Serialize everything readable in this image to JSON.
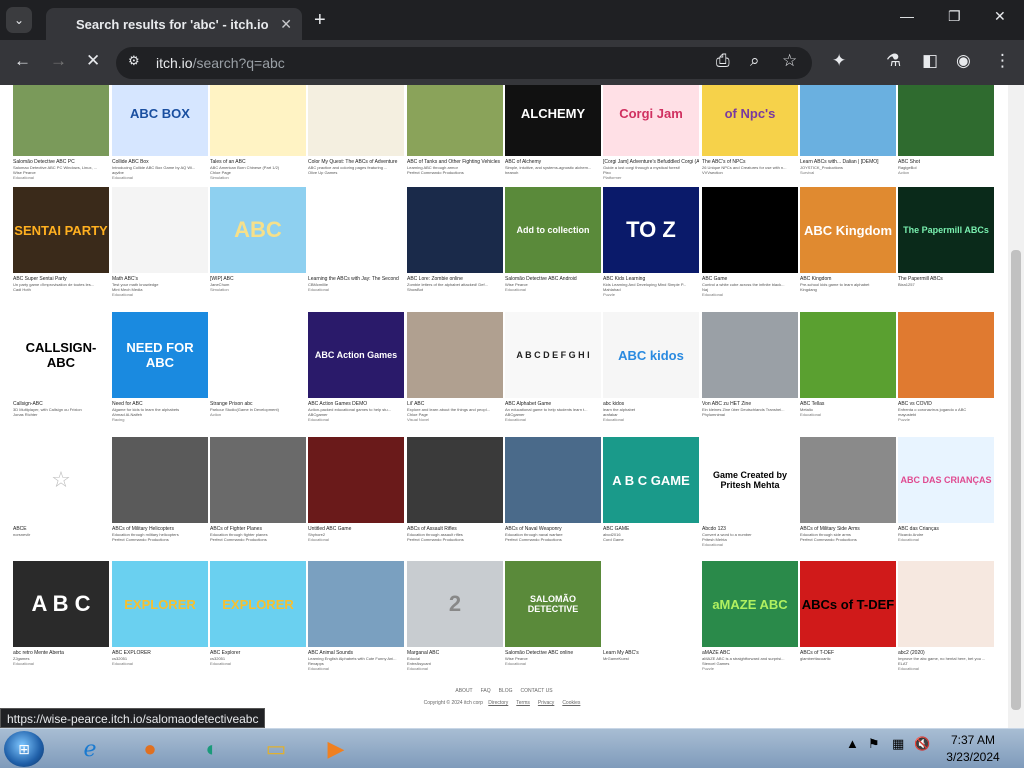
{
  "browser": {
    "tab_title": "Search results for 'abc' - itch.io",
    "url_domain": "itch.io",
    "url_path": "/search?q=abc",
    "status_url": "https://wise-pearce.itch.io/salomaodetectiveabc"
  },
  "rows": [
    [
      {
        "title": "Salomão Detective ABC PC",
        "desc": "Salomao Detective ABC PC Windows, Linux, ...",
        "author": "Wise Pearce",
        "genre": "Educational",
        "bg": "#7a9a5a",
        "fg": "#fff",
        "label": ""
      },
      {
        "title": "Collide ABC Box",
        "desc": "Introducing Collide ABC Box Game by AQ Wi...",
        "author": "aqvibe",
        "genre": "Educational",
        "bg": "#d6e6ff",
        "fg": "#1a4fa0",
        "label": "ABC BOX"
      },
      {
        "title": "Tales of an ABC",
        "desc": "ABC American Born Chinese (Part 1/2)",
        "author": "Chloe Page",
        "genre": "Simulation",
        "bg": "#fff3c4",
        "fg": "#a06a20",
        "label": ""
      },
      {
        "title": "Color My Quest: The ABCs of Adventure",
        "desc": "ABC practice and coloring pages featuring ...",
        "author": "Olive Up Games",
        "genre": "",
        "bg": "#f4efe0",
        "fg": "#5a4a2a",
        "label": ""
      },
      {
        "title": "ABC of Tanks and Other Fighting Vehicles",
        "desc": "Learning ABC through armor",
        "author": "Perfect Commando Productions",
        "genre": "",
        "bg": "#8aa35a",
        "fg": "#fff",
        "label": ""
      },
      {
        "title": "ABC of Alchemy",
        "desc": "Simple, intuitive, and systems-agnostic alchem...",
        "author": "heanoh",
        "genre": "",
        "bg": "#111",
        "fg": "#fff",
        "label": "ALCHEMY"
      },
      {
        "title": "[Corgi Jam] Adventure's Befuddled Corgi (ABC)",
        "desc": "Guide a lost corgi through a mystical forest!",
        "author": "Pixo",
        "genre": "Platformer",
        "bg": "#ffe0e6",
        "fg": "#d03060",
        "label": "Corgi Jam"
      },
      {
        "title": "The ABC's of NPCs",
        "desc": "26 Unique NPCs and Creatures for use with n...",
        "author": "VVVsection",
        "genre": "",
        "bg": "#f6d24a",
        "fg": "#7a3aa0",
        "label": "of Npc's"
      },
      {
        "title": "Learn ABCs with... Dalian | [DEMO]",
        "desc": "",
        "author": "JOYSTICK_Productions",
        "genre": "Survival",
        "bg": "#6ab0e0",
        "fg": "#fff",
        "label": ""
      },
      {
        "title": "ABC Shot",
        "desc": "",
        "author": "RagigeBol",
        "genre": "Action",
        "bg": "#2f6b2f",
        "fg": "#fff",
        "label": ""
      }
    ],
    [
      {
        "title": "ABC Super Sentai Party",
        "desc": "Un party game d'improvisation de toutes les...",
        "author": "Cadi Hoth",
        "genre": "",
        "bg": "#3a2a1a",
        "fg": "#ffb020",
        "label": "SENTAI PARTY"
      },
      {
        "title": "Math ABC's",
        "desc": "Test your math knowledge",
        "author": "Mint Mech Media",
        "genre": "Educational",
        "bg": "#f4f4f4",
        "fg": "#333",
        "label": ""
      },
      {
        "title": "[WIP] ABC",
        "desc": "",
        "author": "JaneChum",
        "genre": "Simulation",
        "bg": "#8ed0f0",
        "fg": "#f6e08a",
        "label": "ABC"
      },
      {
        "title": "Learning the ABCs with Jay: The Second",
        "desc": "",
        "author": "CBMcmillie",
        "genre": "Educational",
        "bg": "#fff",
        "fg": "#6a3a20",
        "label": ""
      },
      {
        "title": "ABC Lore: Zombie online",
        "desc": "Zombie letters of the alphabet attacked! Def...",
        "author": "ShowBot",
        "genre": "",
        "bg": "#1a2a4a",
        "fg": "#fff",
        "label": ""
      },
      {
        "title": "Salomão Detective ABC Android",
        "desc": "",
        "author": "Wise Pearce",
        "genre": "Educational",
        "bg": "#5a8a3a",
        "fg": "#fff",
        "label": "Add to collection"
      },
      {
        "title": "ABC Kids Learning",
        "desc": "Kids Learning And Developing Mind Simple P...",
        "author": "Mahlahad",
        "genre": "Puzzle",
        "bg": "#0a1a6a",
        "fg": "#fff",
        "label": "TO Z"
      },
      {
        "title": "ABC Game",
        "desc": "Control a white cube across the infinite black...",
        "author": "Naj",
        "genre": "Educational",
        "bg": "#000",
        "fg": "#fff",
        "label": ""
      },
      {
        "title": "ABC Kingdom",
        "desc": "Pre-school kids game to learn alphabet",
        "author": "Kingdang",
        "genre": "",
        "bg": "#e08a30",
        "fg": "#fff",
        "label": "ABC Kingdom"
      },
      {
        "title": "The Papermill ABCs",
        "desc": "",
        "author": "Bixa1257",
        "genre": "",
        "bg": "#0a2a1a",
        "fg": "#7af0b0",
        "label": "The Papermill ABCs"
      }
    ],
    [
      {
        "title": "Callsign-ABC",
        "desc": "3D Multiplayer, with Callsign ou Frixion",
        "author": "Jonas Richter",
        "genre": "",
        "bg": "#fff",
        "fg": "#000",
        "label": "CALLSIGN-ABC"
      },
      {
        "title": "Need for ABC",
        "desc": "Algame for kids to learn the alphabets",
        "author": "Ahmad Al-Naifeh",
        "genre": "Racing",
        "bg": "#1a8ae0",
        "fg": "#fff",
        "label": "NEED FOR ABC"
      },
      {
        "title": "Strange Prison abc",
        "desc": "Parkour Studio(Game in Development)",
        "author": "",
        "genre": "Action",
        "bg": "#fff",
        "fg": "#e04a20",
        "label": ""
      },
      {
        "title": "ABC Action Games DEMO",
        "desc": "Action-packed educational games to help stu...",
        "author": "ABCgamer",
        "genre": "Educational",
        "bg": "#2a1a6a",
        "fg": "#fff",
        "label": "ABC Action Games"
      },
      {
        "title": "Lil' ABC",
        "desc": "Explore and learn about the things and peopl...",
        "author": "Chloe Page",
        "genre": "Visual Novel",
        "bg": "#b0a090",
        "fg": "#fff",
        "label": ""
      },
      {
        "title": "ABC Alphabet Game",
        "desc": "An educational game to help students learn t...",
        "author": "ABCgamer",
        "genre": "Educational",
        "bg": "#f8f8f8",
        "fg": "#222",
        "label": "A B C D E F G H I"
      },
      {
        "title": "abc kidos",
        "desc": "learn the alphabet",
        "author": "arafakar",
        "genre": "Educational",
        "bg": "#f6f6f6",
        "fg": "#2a8ae0",
        "label": "ABC kidos"
      },
      {
        "title": "Von ABC zu HET Zine",
        "desc": "Ein kleines Zine über Deutschlands Transhei...",
        "author": "Phylumnimal",
        "genre": "",
        "bg": "#9aa0a6",
        "fg": "#fff",
        "label": ""
      },
      {
        "title": "ABC Tellas",
        "desc": "Metalio",
        "author": "",
        "genre": "Educational",
        "bg": "#5aa030",
        "fg": "#fff",
        "label": ""
      },
      {
        "title": "ABC vs COVID",
        "desc": "Enfrenta o coronavírus jogando o ABC",
        "author": "mayustebi",
        "genre": "Puzzle",
        "bg": "#e07a30",
        "fg": "#fff",
        "label": ""
      }
    ],
    [
      {
        "title": "ABCE",
        "desc": "",
        "author": "norsneviir",
        "genre": "",
        "bg": "#fff",
        "fg": "#bbb",
        "label": "☆"
      },
      {
        "title": "ABCs of Military Helicopters",
        "desc": "Education through military helicopters",
        "author": "Perfect Commando Productions",
        "genre": "",
        "bg": "#5a5a5a",
        "fg": "#fff",
        "label": ""
      },
      {
        "title": "ABCs of Fighter Planes",
        "desc": "Education through fighter planes",
        "author": "Perfect Commando Productions",
        "genre": "",
        "bg": "#6a6a6a",
        "fg": "#fff",
        "label": ""
      },
      {
        "title": "Untitled ABC Game",
        "desc": "",
        "author": "Shyhore2",
        "genre": "Educational",
        "bg": "#6a1a1a",
        "fg": "#fff",
        "label": ""
      },
      {
        "title": "ABCs of Assault Rifles",
        "desc": "Education through assault rifles",
        "author": "Perfect Commando Productions",
        "genre": "",
        "bg": "#3a3a3a",
        "fg": "#fff",
        "label": ""
      },
      {
        "title": "ABCs of Naval Weaponry",
        "desc": "Education through naval warfare",
        "author": "Perfect Commando Productions",
        "genre": "",
        "bg": "#4a6a8a",
        "fg": "#fff",
        "label": ""
      },
      {
        "title": "ABC GAME",
        "desc": "abcd2016",
        "author": "Cord Game",
        "genre": "",
        "bg": "#1a9a8a",
        "fg": "#fff",
        "label": "A B C GAME"
      },
      {
        "title": "Abcdo 123",
        "desc": "Convert a word to a number",
        "author": "Pritesh Mehta",
        "genre": "Educational",
        "bg": "#fff",
        "fg": "#000",
        "label": "Game Created by Pritesh Mehta"
      },
      {
        "title": "ABCs of Military Side Arms",
        "desc": "Education through side arms",
        "author": "Perfect Commando Productions",
        "genre": "",
        "bg": "#8a8a8a",
        "fg": "#fff",
        "label": ""
      },
      {
        "title": "ABC das Crianças",
        "desc": "Ricardo Andre",
        "author": "",
        "genre": "Educational",
        "bg": "#e8f4ff",
        "fg": "#e04a90",
        "label": "ABC DAS CRIANÇAS"
      }
    ],
    [
      {
        "title": "abc retro Mente Aberta",
        "desc": "",
        "author": "ZJgames",
        "genre": "Educational",
        "bg": "#2a2a2a",
        "fg": "#fff",
        "label": "A B C"
      },
      {
        "title": "ABC EXPLORER",
        "desc": "",
        "author": "cs32051",
        "genre": "Educational",
        "bg": "#6ad0f0",
        "fg": "#f6c030",
        "label": "EXPLORER"
      },
      {
        "title": "ABC Explorer",
        "desc": "",
        "author": "cs32051",
        "genre": "Educational",
        "bg": "#6ad0f0",
        "fg": "#f6c030",
        "label": "EXPLORER"
      },
      {
        "title": "ABC Animal Sounds",
        "desc": "Learning English Alphabets with Cute Funny Ani...",
        "author": "Rexapps",
        "genre": "Educational",
        "bg": "#7aa0c0",
        "fg": "#fff",
        "label": ""
      },
      {
        "title": "Marganal ABC",
        "desc": "Educial",
        "author": "EntreAsycant",
        "genre": "Educational",
        "bg": "#c8ccd0",
        "fg": "#888",
        "label": "2"
      },
      {
        "title": "Salomão Detective ABC online",
        "desc": "",
        "author": "Wise Pearce",
        "genre": "Educational",
        "bg": "#5a8a3a",
        "fg": "#fff",
        "label": "SALOMÃO DETECTIVE"
      },
      {
        "title": "Learn My ABC's",
        "desc": "",
        "author": "MrGameKuest",
        "genre": "",
        "bg": "#fff",
        "fg": "#2a2a8a",
        "label": ""
      },
      {
        "title": "aMAZE ABC",
        "desc": "aMAZE ABC is a straightforward and surprisi...",
        "author": "Stencel Games",
        "genre": "Puzzle",
        "bg": "#2a8a4a",
        "fg": "#b0f060",
        "label": "aMAZE ABC"
      },
      {
        "title": "ABCs of T-DEF",
        "desc": "glamberttacoartic",
        "author": "",
        "genre": "",
        "bg": "#d01a1a",
        "fg": "#000",
        "label": "ABCs of T-DEF"
      },
      {
        "title": "abc2 (2020)",
        "desc": "Improve the abc game, no hental here, bet you ...",
        "author": "ELAT",
        "genre": "Educational",
        "bg": "#f6e8e0",
        "fg": "#6a3a20",
        "label": ""
      }
    ]
  ],
  "footer": {
    "links": [
      "ABOUT",
      "FAQ",
      "BLOG",
      "CONTACT US"
    ],
    "copyright": "Copyright © 2024 itch corp",
    "legal": [
      "Directory",
      "Terms",
      "Privacy",
      "Cookies"
    ]
  },
  "taskbar": {
    "time": "7:37 AM",
    "date": "3/23/2024"
  }
}
